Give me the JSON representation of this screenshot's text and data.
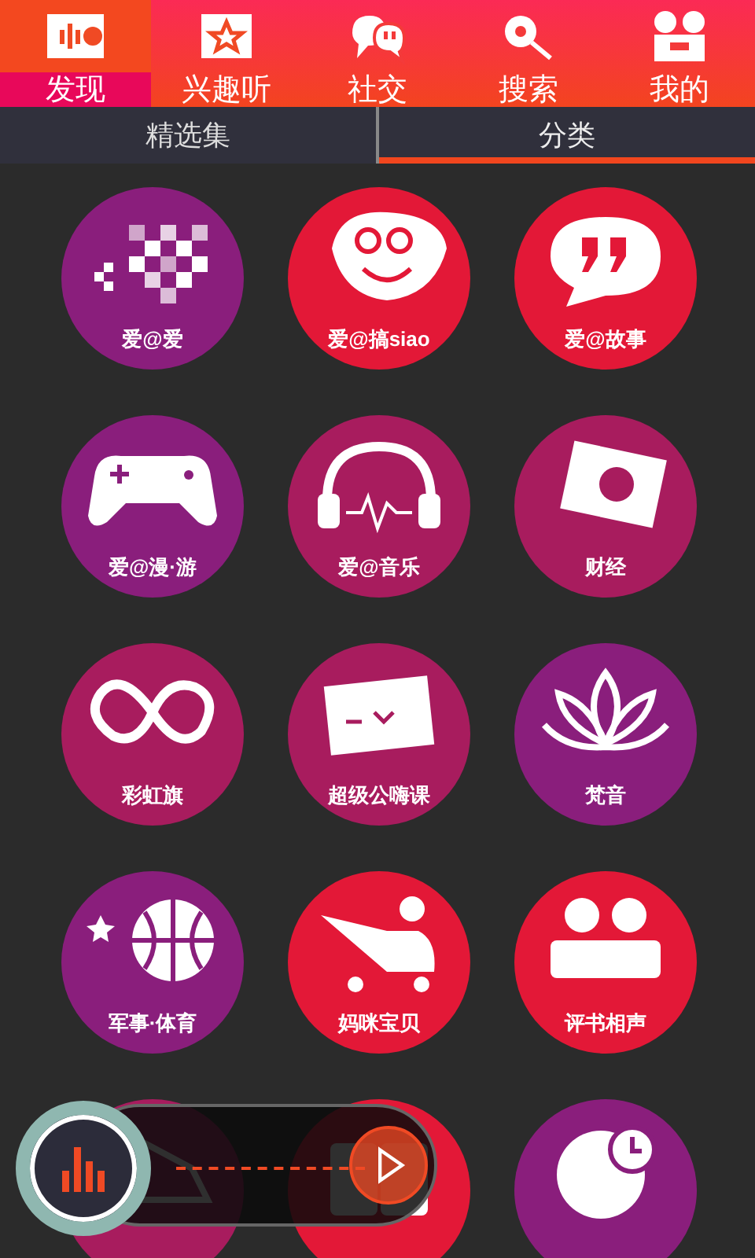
{
  "nav": [
    {
      "label": "发现",
      "kind": "bars",
      "selected": true
    },
    {
      "label": "兴趣听",
      "kind": "star",
      "selected": false
    },
    {
      "label": "社交",
      "kind": "chat",
      "selected": false
    },
    {
      "label": "搜索",
      "kind": "search",
      "selected": false
    },
    {
      "label": "我的",
      "kind": "camera",
      "selected": false
    }
  ],
  "tabs": [
    {
      "label": "精选集",
      "selected": false
    },
    {
      "label": "分类",
      "selected": true
    }
  ],
  "categories": [
    {
      "label": "爱@爱",
      "kind": "heart",
      "color": "#8a1e7c"
    },
    {
      "label": "爱@搞siao",
      "kind": "face",
      "color": "#e31837"
    },
    {
      "label": "爱@故事",
      "kind": "quote",
      "color": "#e31837"
    },
    {
      "label": "爱@漫·游",
      "kind": "gamepad",
      "color": "#8a1e7c"
    },
    {
      "label": "爱@音乐",
      "kind": "headphones",
      "color": "#a81c5e"
    },
    {
      "label": "财经",
      "kind": "money",
      "color": "#a81c5e"
    },
    {
      "label": "彩虹旗",
      "kind": "infinity",
      "color": "#a81c5e"
    },
    {
      "label": "超级公嗨课",
      "kind": "board",
      "color": "#a81c5e"
    },
    {
      "label": "梵音",
      "kind": "lotus",
      "color": "#8a1e7c"
    },
    {
      "label": "军事·体育",
      "kind": "ball",
      "color": "#8a1e7c"
    },
    {
      "label": "妈咪宝贝",
      "kind": "stroller",
      "color": "#e31837"
    },
    {
      "label": "评书相声",
      "kind": "people",
      "color": "#e31837"
    },
    {
      "kind": "shoe",
      "color": "#a81c5e"
    },
    {
      "kind": "phones",
      "color": "#e31837"
    },
    {
      "kind": "globe",
      "color": "#8a1e7c"
    }
  ],
  "player": {
    "playing": false
  }
}
